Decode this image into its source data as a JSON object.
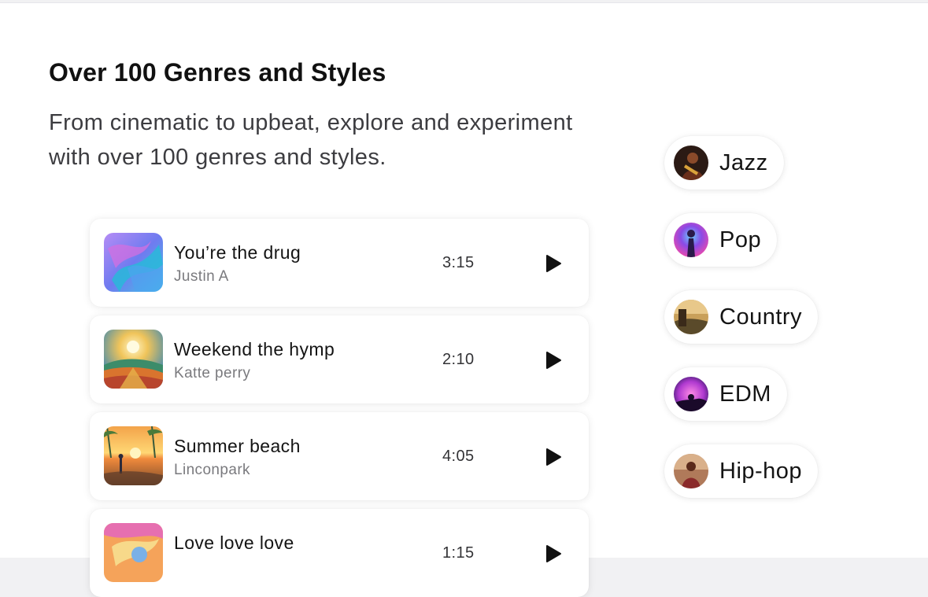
{
  "section": {
    "title": "Over 100 Genres and Styles",
    "description": "From cinematic to upbeat, explore and experiment with over 100 genres and styles."
  },
  "tracks": [
    {
      "title": "You’re the drug",
      "artist": "Justin A",
      "duration": "3:15"
    },
    {
      "title": "Weekend the hymp",
      "artist": "Katte perry",
      "duration": "2:10"
    },
    {
      "title": "Summer beach",
      "artist": "Linconpark",
      "duration": "4:05"
    },
    {
      "title": "Love love love",
      "artist": "",
      "duration": "1:15"
    }
  ],
  "genres": [
    {
      "label": "Jazz"
    },
    {
      "label": "Pop"
    },
    {
      "label": "Country"
    },
    {
      "label": "EDM"
    },
    {
      "label": "Hip-hop"
    }
  ],
  "icons": {
    "play": "play-icon"
  }
}
